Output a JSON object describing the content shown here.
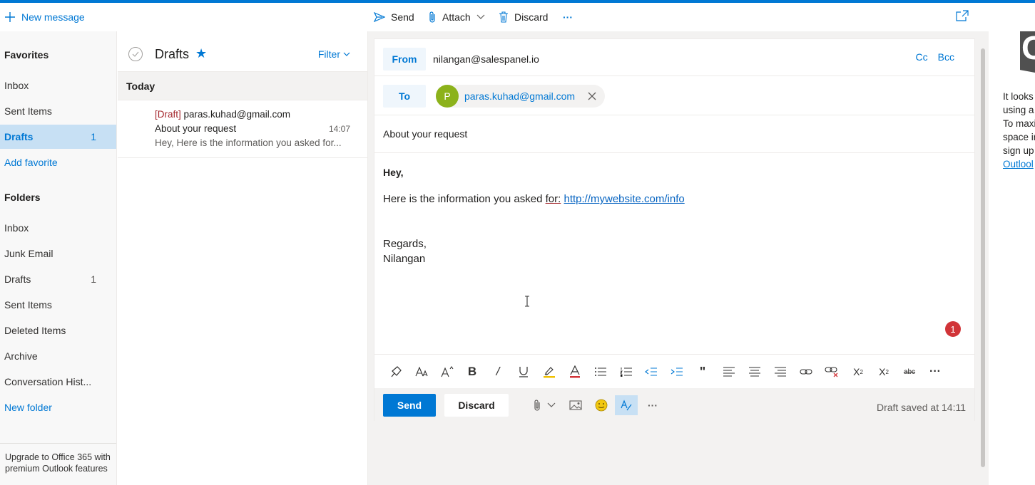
{
  "toolbar": {
    "new_message": "New message",
    "send": "Send",
    "attach": "Attach",
    "discard": "Discard",
    "more": "···"
  },
  "nav": {
    "favorites_heading": "Favorites",
    "favorites": [
      {
        "label": "Inbox",
        "count": ""
      },
      {
        "label": "Sent Items",
        "count": ""
      },
      {
        "label": "Drafts",
        "count": "1"
      },
      {
        "label": "Add favorite",
        "count": ""
      }
    ],
    "folders_heading": "Folders",
    "folders": [
      {
        "label": "Inbox",
        "count": ""
      },
      {
        "label": "Junk Email",
        "count": ""
      },
      {
        "label": "Drafts",
        "count": "1"
      },
      {
        "label": "Sent Items",
        "count": ""
      },
      {
        "label": "Deleted Items",
        "count": ""
      },
      {
        "label": "Archive",
        "count": ""
      },
      {
        "label": "Conversation Hist...",
        "count": ""
      },
      {
        "label": "New folder",
        "count": ""
      }
    ],
    "upgrade": "Upgrade to Office 365 with premium Outlook features"
  },
  "list": {
    "title": "Drafts",
    "filter": "Filter",
    "group": "Today",
    "item": {
      "draft_tag": "[Draft]",
      "from": "paras.kuhad@gmail.com",
      "subject": "About your request",
      "time": "14:07",
      "preview": "Hey, Here is the information you asked for..."
    }
  },
  "compose": {
    "from_label": "From",
    "from_email": "nilangan@salespanel.io",
    "cc": "Cc",
    "bcc": "Bcc",
    "to_label": "To",
    "recipient_initial": "P",
    "recipient_email": "paras.kuhad@gmail.com",
    "subject": "About your request",
    "body": {
      "greeting": "Hey,",
      "line_prefix": "Here is the information you asked ",
      "line_spell": "for:",
      "link": "http://mywebsite.com/info",
      "regards": "Regards,",
      "signature": "Nilangan"
    },
    "badge_count": "1",
    "send": "Send",
    "discard": "Discard",
    "draft_saved": "Draft saved at 14:11"
  },
  "promo": {
    "lines": [
      "It looks",
      "using a",
      "To maxi",
      "space ir",
      "sign up"
    ],
    "link": "Outlool"
  },
  "colors": {
    "accent": "#0078d4",
    "avatar": "#8cb21b",
    "draft_tag": "#a4262c",
    "badge": "#d13438"
  }
}
